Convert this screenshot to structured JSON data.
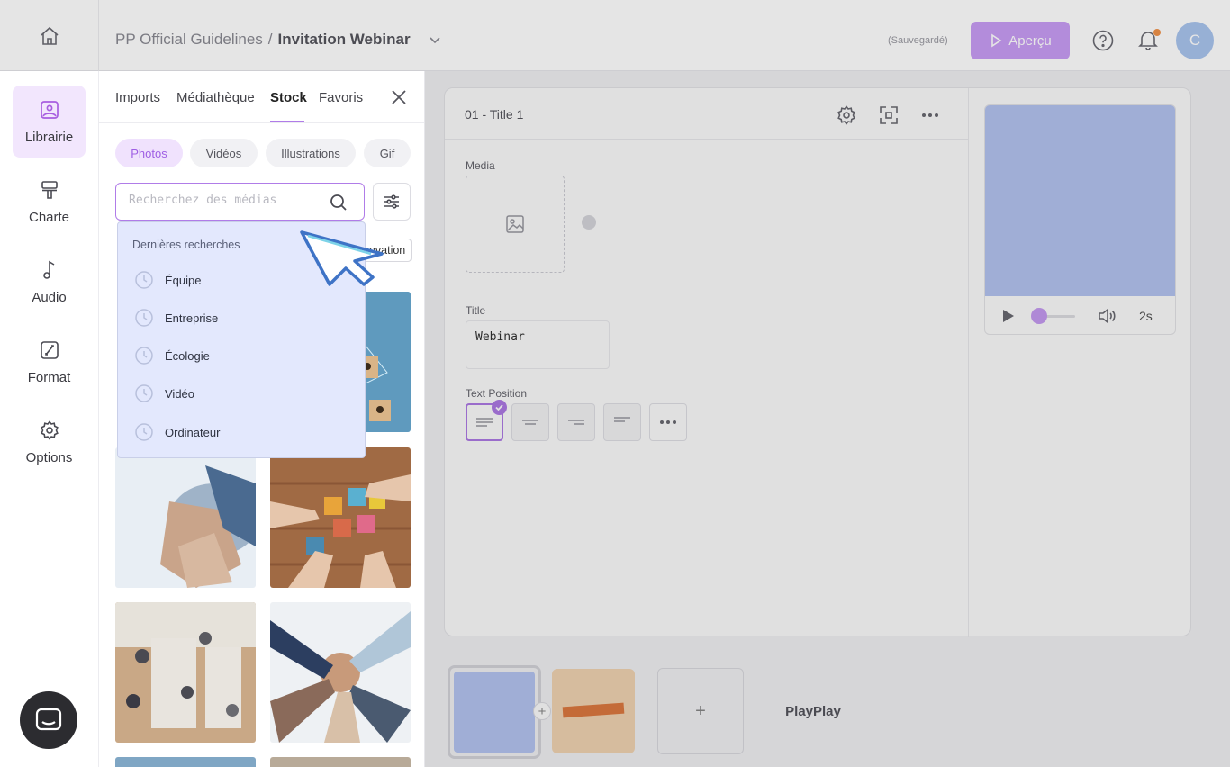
{
  "header": {
    "project": "PP Official Guidelines",
    "separator": "/",
    "document": "Invitation Webinar",
    "save_status": "(Sauvegardé)",
    "preview_label": "Aperçu",
    "avatar_initial": "C"
  },
  "sidebar": {
    "items": [
      {
        "label": "Librairie",
        "icon": "image-icon"
      },
      {
        "label": "Charte",
        "icon": "paint-roller-icon"
      },
      {
        "label": "Audio",
        "icon": "music-note-icon"
      },
      {
        "label": "Format",
        "icon": "resize-icon"
      },
      {
        "label": "Options",
        "icon": "gear-icon"
      }
    ]
  },
  "library": {
    "tabs": [
      "Imports",
      "Médiathèque",
      "Stock",
      "Favoris"
    ],
    "active_tab": "Stock",
    "media_types": [
      "Photos",
      "Vidéos",
      "Illustrations",
      "Gif"
    ],
    "active_media_type": "Photos",
    "search_placeholder": "Recherchez des médias",
    "visible_tag": "novation",
    "recent_title": "Dernières recherches",
    "recent_searches": [
      "Équipe",
      "Entreprise",
      "Écologie",
      "Vidéo",
      "Ordinateur"
    ]
  },
  "editor": {
    "slide_title": "01 - Title 1",
    "media_label": "Media",
    "title_label": "Title",
    "title_value": "Webinar",
    "text_position_label": "Text Position",
    "player_time": "2s"
  },
  "timeline": {
    "add_label": "+",
    "logo_text": "PlayPlay"
  },
  "colors": {
    "accent": "#b07ce8",
    "preview_button": "#c89cf4",
    "dropdown_bg": "#e3e8fd",
    "player_video": "#b7c6f4"
  }
}
